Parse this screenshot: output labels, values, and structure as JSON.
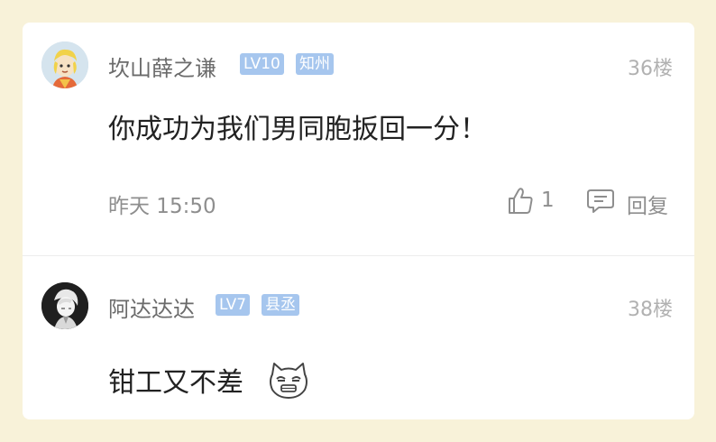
{
  "comments": [
    {
      "username": "坎山薛之谦",
      "level": "LV10",
      "title": "知州",
      "floor": "36楼",
      "text": "你成功为我们男同胞扳回一分！",
      "time": "昨天 15:50",
      "likes": "1",
      "reply_label": "回复",
      "avatar_icon": "cartoon-avatar"
    },
    {
      "username": "阿达达达",
      "level": "LV7",
      "title": "县丞",
      "floor": "38楼",
      "text": "钳工又不差",
      "emoji": "smug-cat-emoji",
      "avatar_icon": "anime-avatar"
    }
  ],
  "colors": {
    "background": "#f8f2d9",
    "badge": "#a6c6ee",
    "username": "#6b6b6b",
    "meta": "#8e8e8e"
  }
}
